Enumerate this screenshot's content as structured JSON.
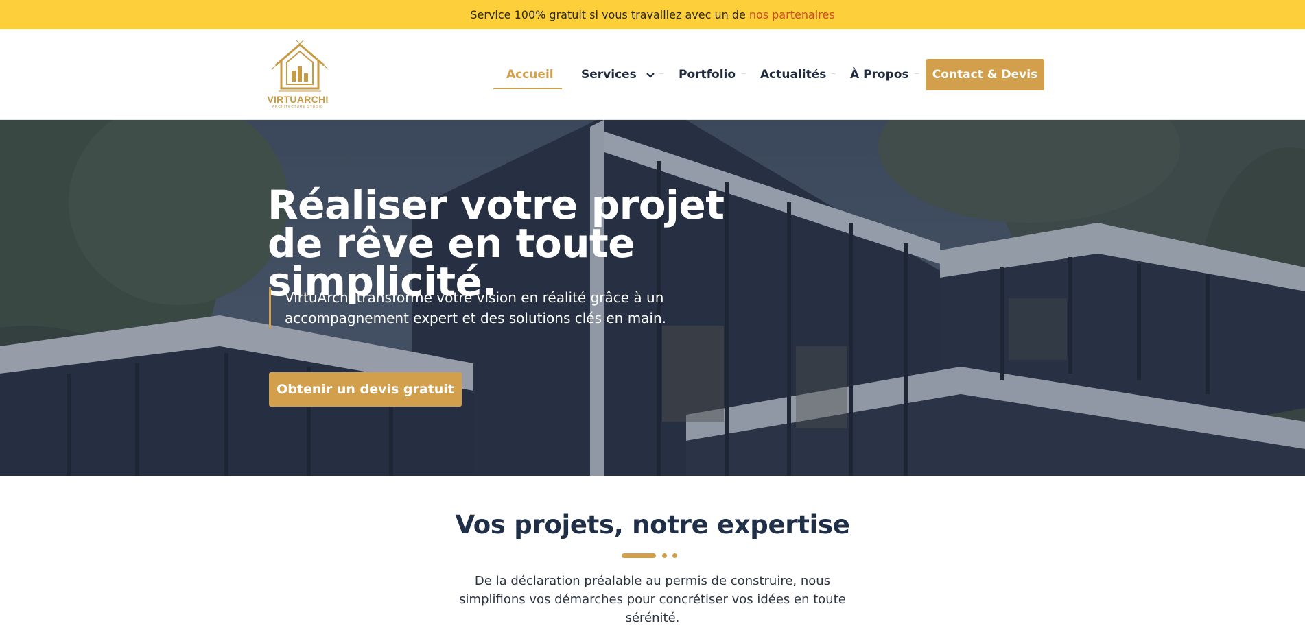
{
  "topbar": {
    "text": "Service 100% gratuit si vous travaillez avec un de",
    "link": "nos partenaires"
  },
  "logo": {
    "brand": "VIRTUARCHI",
    "tagline": "ARCHITECTURE STUDIO"
  },
  "nav": {
    "items": [
      {
        "label": "Accueil",
        "active": true
      },
      {
        "label": "Services",
        "has_dropdown": true
      },
      {
        "label": "Portfolio"
      },
      {
        "label": "Actualités"
      },
      {
        "label": "À Propos"
      }
    ],
    "contact_button": "Contact & Devis"
  },
  "hero": {
    "title": "Réaliser votre projet de rêve en toute simplicité.",
    "subtitle": "VirtuArchi transforme votre vision en réalité grâce à un accompagnement expert et des solutions clés en main.",
    "cta": "Obtenir un devis gratuit"
  },
  "section": {
    "title": "Vos projets, notre expertise",
    "text": "De la déclaration préalable au permis de construire, nous simplifions vos démarches pour concrétiser vos idées en toute sérénité."
  },
  "colors": {
    "accent": "#d2a04c",
    "topbar": "#fdcf3a",
    "link_red": "#d24b2a",
    "navy": "#1f2f48"
  },
  "icons": {
    "logo": "house-logo-icon",
    "dropdown": "chevron-down-icon"
  }
}
